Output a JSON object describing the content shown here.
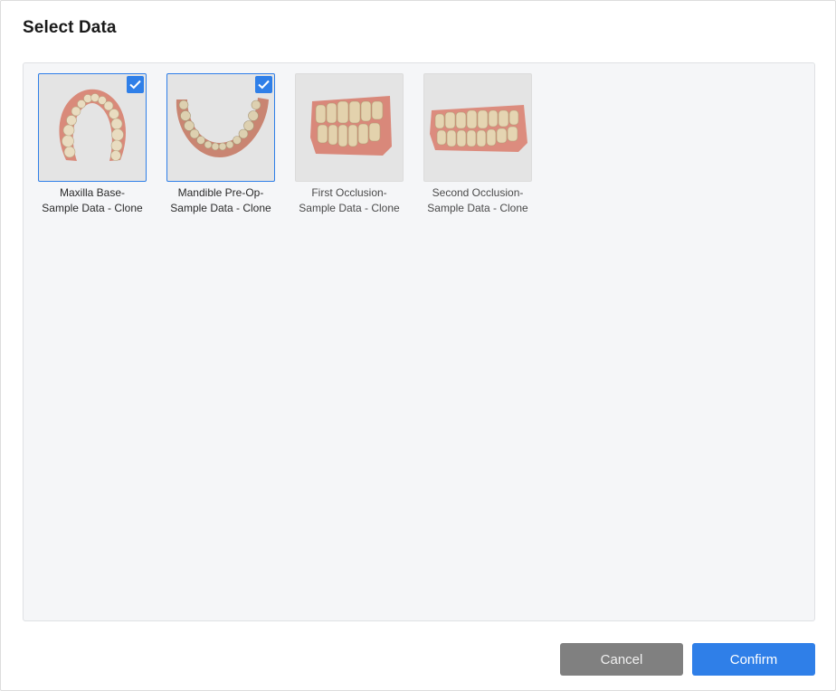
{
  "dialog": {
    "title": "Select Data",
    "items": [
      {
        "line1": "Maxilla Base-",
        "line2": "Sample Data - Clone",
        "selected": true
      },
      {
        "line1": "Mandible Pre-Op-",
        "line2": "Sample Data - Clone",
        "selected": true
      },
      {
        "line1": "First Occlusion-",
        "line2": "Sample Data - Clone",
        "selected": false
      },
      {
        "line1": "Second Occlusion-",
        "line2": "Sample Data - Clone",
        "selected": false
      }
    ],
    "cancel_label": "Cancel",
    "confirm_label": "Confirm"
  },
  "colors": {
    "accent": "#2f7fe8",
    "cancel_bg": "#808080",
    "panel_bg": "#f5f6f8"
  },
  "icons": {
    "checkbox": "checkmark-icon"
  }
}
